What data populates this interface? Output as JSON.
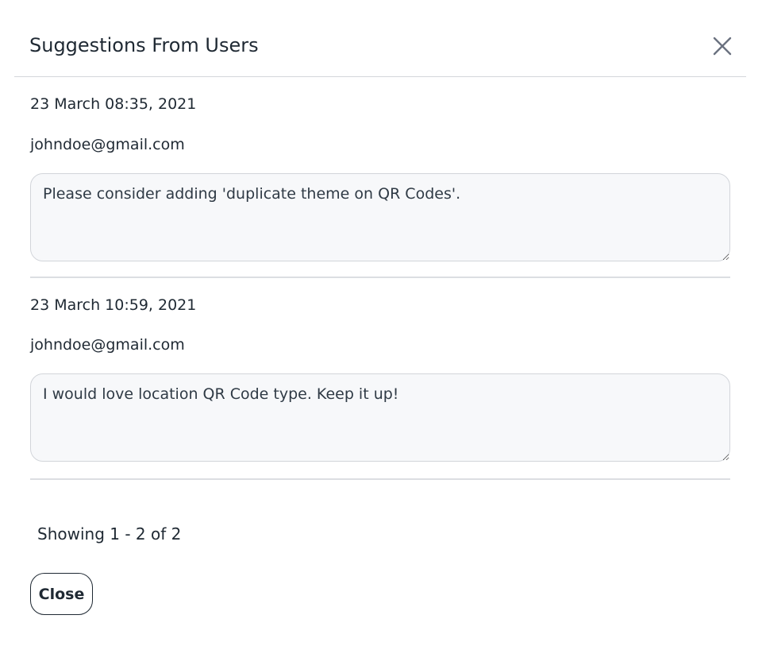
{
  "modal": {
    "title": "Suggestions From Users",
    "close_icon": "close-icon"
  },
  "suggestions": [
    {
      "date": "23 March 08:35, 2021",
      "email": "johndoe@gmail.com",
      "text": "Please consider adding 'duplicate theme on QR Codes'."
    },
    {
      "date": "23 March 10:59, 2021",
      "email": "johndoe@gmail.com",
      "text": "I would love location QR Code type. Keep it up!"
    }
  ],
  "pagination": {
    "info": "Showing 1 - 2 of 2"
  },
  "footer": {
    "close_label": "Close"
  },
  "colors": {
    "text": "#1f2933",
    "textarea_bg": "#f7f8fa",
    "border": "#d2d5da",
    "close_icon": "#6b7280"
  }
}
